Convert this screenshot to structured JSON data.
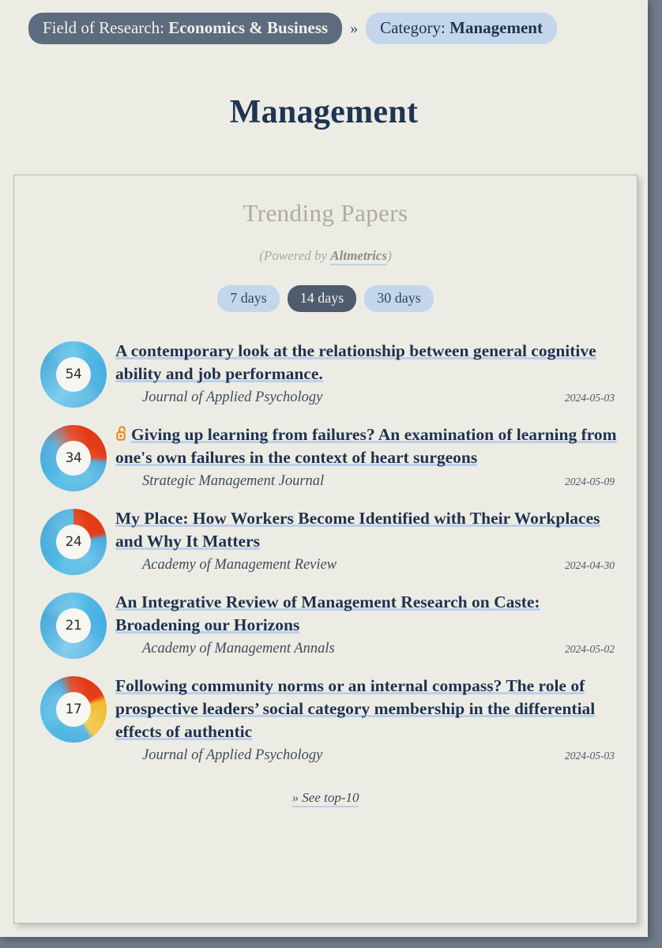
{
  "breadcrumb": {
    "field_label": "Field of Research:",
    "field_value": "Economics & Business",
    "separator": "»",
    "category_label": "Category:",
    "category_value": "Management"
  },
  "page_title": "Management",
  "card": {
    "title": "Trending Papers",
    "powered_prefix": "(Powered by ",
    "powered_brand": "Altmetrics",
    "powered_suffix": ")",
    "filters": [
      {
        "label": "7 days",
        "active": false
      },
      {
        "label": "14 days",
        "active": true
      },
      {
        "label": "30 days",
        "active": false
      }
    ],
    "see_more": "» See top-10"
  },
  "papers": [
    {
      "score": "54",
      "open_access": false,
      "title": "A contemporary look at the relationship between general cognitive ability and job performance.",
      "journal": "Journal of Applied Psychology",
      "date": "2024-05-03",
      "donut_colors": {
        "blue": "#4bb4e2",
        "red": "",
        "yellow": ""
      },
      "donut_gradient": "conic-gradient(from 0deg, #5cc0e8 0deg, #37a7dd 120deg, #7fcdec 215deg, #2f9fd6 300deg, #5cc0e8 360deg)"
    },
    {
      "score": "34",
      "open_access": true,
      "title": "Giving up learning from failures? An examination of learning from one's own failures in the context of heart surgeons",
      "journal": "Strategic Management Journal",
      "date": "2024-05-09",
      "donut_colors": {
        "blue": "#4bb4e2",
        "red": "#e23b16",
        "yellow": ""
      },
      "donut_gradient": "conic-gradient(from 0deg, #e23b16 0deg, #e23b16 88deg, #3fa9dd 100deg, #5cc0e8 210deg, #2f9fd6 300deg, #d83a18 352deg, #e23b16 360deg)"
    },
    {
      "score": "24",
      "open_access": false,
      "title": "My Place: How Workers Become Identified with Their Workplaces and Why It Matters",
      "journal": "Academy of Management Review",
      "date": "2024-04-30",
      "donut_colors": {
        "blue": "#4bb4e2",
        "red": "#e23b16",
        "yellow": ""
      },
      "donut_gradient": "conic-gradient(from 0deg, #e23b16 0deg, #e23b16 72deg, #3fa9dd 84deg, #5cc0e8 200deg, #2f9fd6 300deg, #4bb4e2 360deg)"
    },
    {
      "score": "21",
      "open_access": false,
      "title": "An Integrative Review of Management Research on Caste: Broadening our Horizons",
      "journal": "Academy of Management Annals",
      "date": "2024-05-02",
      "donut_colors": {
        "blue": "#4bb4e2",
        "red": "",
        "yellow": ""
      },
      "donut_gradient": "conic-gradient(from 0deg, #5cc0e8 0deg, #37a7dd 110deg, #7fcdec 200deg, #2f9fd6 290deg, #5cc0e8 360deg)"
    },
    {
      "score": "17",
      "open_access": false,
      "title": "Following community norms or an internal compass? The role of prospective leaders’ social category membership in the differential effects of authentic",
      "journal": "Journal of Applied Psychology",
      "date": "2024-05-03",
      "donut_colors": {
        "blue": "#4bb4e2",
        "red": "#e23b16",
        "yellow": "#f2c033"
      },
      "donut_gradient": "conic-gradient(from 0deg, #e23b16 0deg, #e23b16 62deg, #f0b928 74deg, #f2c033 140deg, #3fa9dd 152deg, #5cc0e8 250deg, #2f9fd6 330deg, #d83a18 356deg, #e23b16 360deg)"
    }
  ],
  "colors": {
    "page_background": "#717b8b",
    "sheet_background": "#edece4",
    "accent_dark": "#5d6b7e",
    "accent_light": "#c3d6ec",
    "title_color": "#1f3552",
    "underline": "#bdd0e8",
    "open_access": "#e8871e"
  }
}
